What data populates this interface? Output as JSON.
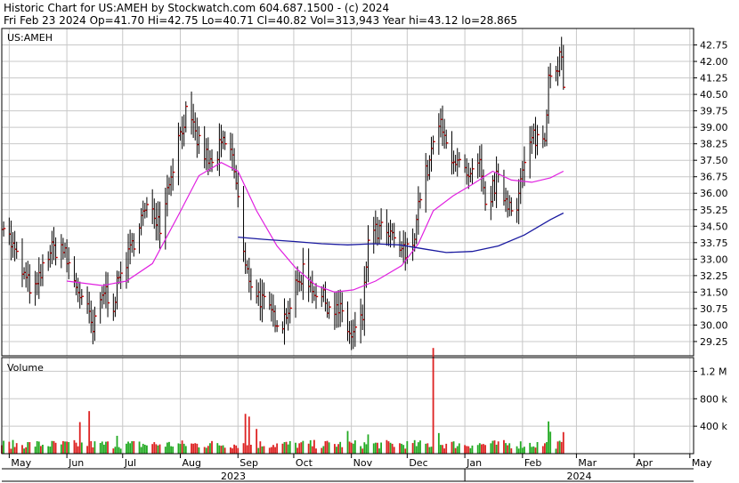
{
  "header": {
    "line1": "Historic Chart for US:AMEH by Stockwatch.com 604.687.1500 - (c) 2024",
    "line2": "Fri Feb 23 2024   Op=41.70  Hi=42.75  Lo=40.71  Cl=40.82  Vol=313,943  Year hi=43.12  lo=28.865"
  },
  "colors": {
    "bar": "#000000",
    "close_tick": "#cc0000",
    "ma_short": "#e020e0",
    "ma_long": "#1a1aa0",
    "volume_up": "#22aa22",
    "volume_down": "#dd2222",
    "grid": "#c8c8c8",
    "border": "#000000"
  },
  "chart_data": [
    {
      "type": "line",
      "subtype": "ohlc",
      "label": "US:AMEH",
      "ylim": [
        28.6,
        43.5
      ],
      "y_ticks": [
        29.25,
        30.0,
        30.75,
        31.5,
        32.25,
        33.0,
        33.75,
        34.5,
        35.25,
        36.0,
        36.75,
        37.5,
        38.25,
        39.0,
        39.75,
        40.5,
        41.25,
        42.0,
        42.75
      ],
      "y_tick_labels": [
        "29.25",
        "30.00",
        "30.75",
        "31.50",
        "32.25",
        "33.00",
        "33.75",
        "34.50",
        "35.25",
        "36.00",
        "36.75",
        "37.50",
        "38.25",
        "39.00",
        "39.75",
        "40.50",
        "41.25",
        "42.00",
        "42.75"
      ],
      "grid": true,
      "x_range": [
        "2023-04-27",
        "2024-05-03"
      ],
      "price_anchors": [
        [
          "2023-04-27",
          34.8
        ],
        [
          "2023-05-03",
          33.5
        ],
        [
          "2023-05-10",
          32.0
        ],
        [
          "2023-05-15",
          31.5
        ],
        [
          "2023-05-22",
          33.3
        ],
        [
          "2023-05-29",
          33.6
        ],
        [
          "2023-06-05",
          32.0
        ],
        [
          "2023-06-12",
          30.6
        ],
        [
          "2023-06-15",
          29.7
        ],
        [
          "2023-06-21",
          31.6
        ],
        [
          "2023-06-26",
          31.0
        ],
        [
          "2023-06-30",
          32.4
        ],
        [
          "2023-07-05",
          33.3
        ],
        [
          "2023-07-10",
          34.8
        ],
        [
          "2023-07-17",
          35.4
        ],
        [
          "2023-07-21",
          34.6
        ],
        [
          "2023-07-27",
          37.0
        ],
        [
          "2023-08-01",
          38.8
        ],
        [
          "2023-08-04",
          39.6
        ],
        [
          "2023-08-09",
          38.6
        ],
        [
          "2023-08-14",
          37.8
        ],
        [
          "2023-08-18",
          37.2
        ],
        [
          "2023-08-23",
          38.2
        ],
        [
          "2023-08-28",
          38.0
        ],
        [
          "2023-08-31",
          36.5
        ],
        [
          "2023-09-05",
          32.5
        ],
        [
          "2023-09-11",
          31.5
        ],
        [
          "2023-09-18",
          30.5
        ],
        [
          "2023-09-25",
          30.2
        ],
        [
          "2023-10-02",
          31.6
        ],
        [
          "2023-10-06",
          32.5
        ],
        [
          "2023-10-13",
          31.5
        ],
        [
          "2023-10-20",
          30.9
        ],
        [
          "2023-10-27",
          30.5
        ],
        [
          "2023-11-01",
          29.4
        ],
        [
          "2023-11-07",
          30.3
        ],
        [
          "2023-11-10",
          34.0
        ],
        [
          "2023-11-17",
          34.3
        ],
        [
          "2023-11-24",
          33.8
        ],
        [
          "2023-11-30",
          33.2
        ],
        [
          "2023-12-04",
          33.8
        ],
        [
          "2023-12-08",
          36.0
        ],
        [
          "2023-12-13",
          37.4
        ],
        [
          "2023-12-18",
          39.2
        ],
        [
          "2023-12-22",
          38.2
        ],
        [
          "2023-12-28",
          37.4
        ],
        [
          "2024-01-03",
          36.5
        ],
        [
          "2024-01-09",
          37.2
        ],
        [
          "2024-01-12",
          35.3
        ],
        [
          "2024-01-18",
          36.6
        ],
        [
          "2024-01-24",
          35.6
        ],
        [
          "2024-01-29",
          35.6
        ],
        [
          "2024-02-02",
          37.3
        ],
        [
          "2024-02-07",
          38.6
        ],
        [
          "2024-02-13",
          38.4
        ],
        [
          "2024-02-15",
          41.5
        ],
        [
          "2024-02-22",
          42.2
        ],
        [
          "2024-02-23",
          40.82
        ]
      ],
      "ma_short": {
        "name": "",
        "points": [
          [
            "2023-06-01",
            32.0
          ],
          [
            "2023-06-20",
            31.8
          ],
          [
            "2023-07-03",
            32.0
          ],
          [
            "2023-07-17",
            32.8
          ],
          [
            "2023-07-31",
            35.0
          ],
          [
            "2023-08-11",
            36.8
          ],
          [
            "2023-08-23",
            37.4
          ],
          [
            "2023-09-01",
            37.0
          ],
          [
            "2023-09-11",
            35.2
          ],
          [
            "2023-09-22",
            33.6
          ],
          [
            "2023-10-02",
            32.6
          ],
          [
            "2023-10-13",
            31.8
          ],
          [
            "2023-10-23",
            31.5
          ],
          [
            "2023-11-02",
            31.6
          ],
          [
            "2023-11-14",
            32.0
          ],
          [
            "2023-11-28",
            32.7
          ],
          [
            "2023-12-07",
            33.7
          ],
          [
            "2023-12-15",
            35.2
          ],
          [
            "2023-12-26",
            35.9
          ],
          [
            "2024-01-05",
            36.4
          ],
          [
            "2024-01-16",
            37.0
          ],
          [
            "2024-01-26",
            36.6
          ],
          [
            "2024-02-06",
            36.5
          ],
          [
            "2024-02-16",
            36.7
          ],
          [
            "2024-02-23",
            37.0
          ]
        ]
      },
      "ma_long": {
        "name": "",
        "points": [
          [
            "2023-09-01",
            34.0
          ],
          [
            "2023-09-15",
            33.9
          ],
          [
            "2023-10-02",
            33.8
          ],
          [
            "2023-10-16",
            33.7
          ],
          [
            "2023-10-30",
            33.65
          ],
          [
            "2023-11-13",
            33.7
          ],
          [
            "2023-11-27",
            33.65
          ],
          [
            "2023-12-11",
            33.45
          ],
          [
            "2023-12-22",
            33.3
          ],
          [
            "2024-01-05",
            33.35
          ],
          [
            "2024-01-19",
            33.6
          ],
          [
            "2024-02-02",
            34.1
          ],
          [
            "2024-02-16",
            34.8
          ],
          [
            "2024-02-23",
            35.1
          ]
        ]
      }
    },
    {
      "type": "bar",
      "label": "Volume",
      "ylim": [
        0,
        1400000
      ],
      "y_ticks": [
        400000,
        800000,
        1200000
      ],
      "y_tick_labels": [
        "400 k",
        "800 k",
        "1.2 M"
      ],
      "base_volume": 200000,
      "spikes": [
        [
          "2023-06-13",
          620000,
          "down"
        ],
        [
          "2023-06-08",
          460000,
          "down"
        ],
        [
          "2023-06-28",
          260000,
          "up"
        ],
        [
          "2023-09-05",
          580000,
          "down"
        ],
        [
          "2023-09-07",
          540000,
          "down"
        ],
        [
          "2023-09-11",
          360000,
          "down"
        ],
        [
          "2023-10-30",
          330000,
          "up"
        ],
        [
          "2023-11-10",
          280000,
          "up"
        ],
        [
          "2023-12-15",
          1540000,
          "down"
        ],
        [
          "2023-12-18",
          300000,
          "up"
        ],
        [
          "2024-02-15",
          470000,
          "up"
        ],
        [
          "2024-02-16",
          320000,
          "up"
        ],
        [
          "2024-02-23",
          313943,
          "down"
        ]
      ]
    }
  ],
  "x_axis": {
    "months": [
      {
        "label": "May",
        "date": "2023-05-01"
      },
      {
        "label": "Jun",
        "date": "2023-06-01"
      },
      {
        "label": "Jul",
        "date": "2023-07-01"
      },
      {
        "label": "Aug",
        "date": "2023-08-01"
      },
      {
        "label": "Sep",
        "date": "2023-09-01"
      },
      {
        "label": "Oct",
        "date": "2023-10-01"
      },
      {
        "label": "Nov",
        "date": "2023-11-01"
      },
      {
        "label": "Dec",
        "date": "2023-12-01"
      },
      {
        "label": "Jan",
        "date": "2024-01-01"
      },
      {
        "label": "Feb",
        "date": "2024-02-01"
      },
      {
        "label": "Mar",
        "date": "2024-03-01"
      },
      {
        "label": "Apr",
        "date": "2024-04-01"
      },
      {
        "label": "May",
        "date": "2024-05-01"
      }
    ],
    "years": [
      {
        "label": "2023",
        "start": "2023-04-27",
        "end": "2024-01-01"
      },
      {
        "label": "2024",
        "start": "2024-01-01",
        "end": "2024-05-03"
      }
    ]
  }
}
